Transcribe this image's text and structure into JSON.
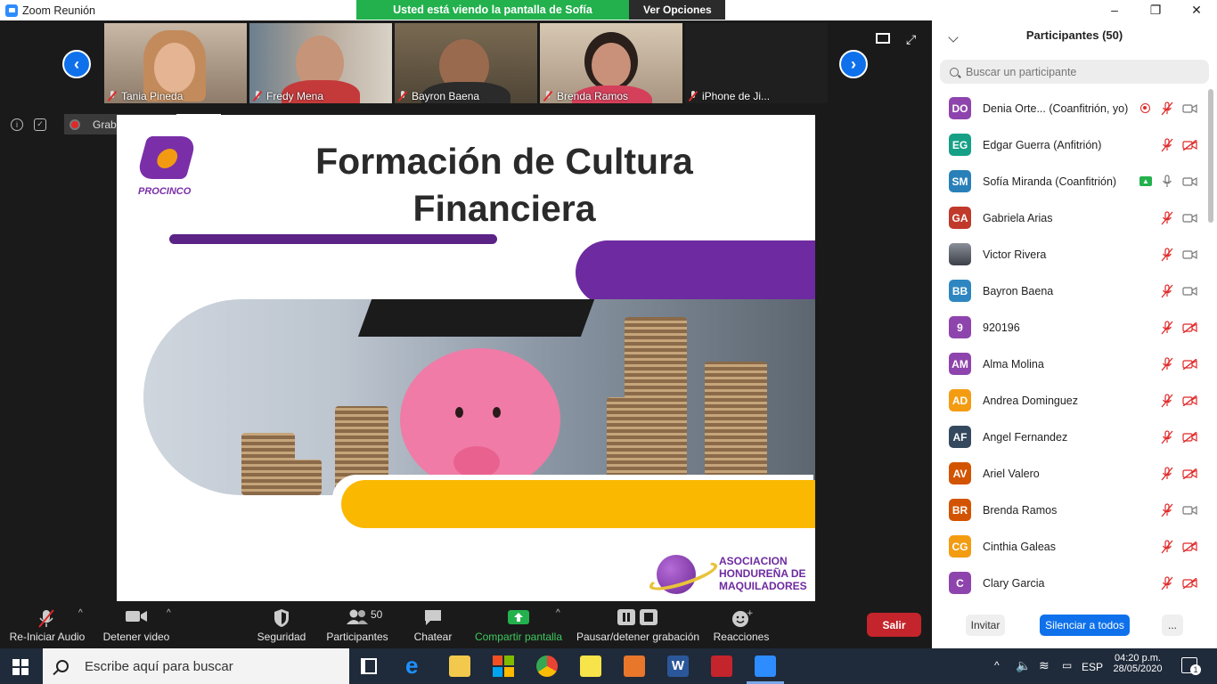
{
  "window": {
    "title": "Zoom Reunión"
  },
  "share_banner": {
    "text": "Usted está viendo la pantalla de Sofía Miranda",
    "options_label": "Ver Opciones"
  },
  "video_tiles": [
    {
      "name": "Tania Pineda"
    },
    {
      "name": "Fredy Mena"
    },
    {
      "name": "Bayron Baena"
    },
    {
      "name": "Brenda Ramos"
    },
    {
      "name": "iPhone de Ji..."
    }
  ],
  "recording": {
    "status": "Grabando..."
  },
  "slide": {
    "logo_text": "PROCINCO",
    "title_line1": "Formación de Cultura",
    "title_line2": "Financiera",
    "org_line1": "ASOCIACION",
    "org_line2": "HONDUREÑA DE",
    "org_line3": "MAQUILADORES"
  },
  "toolbar": {
    "audio": "Re-Iniciar Audio",
    "video": "Detener video",
    "security": "Seguridad",
    "participants": "Participantes",
    "participants_count": "50",
    "chat": "Chatear",
    "share": "Compartir pantalla",
    "recording": "Pausar/detener grabación",
    "reactions": "Reacciones",
    "leave": "Salir"
  },
  "panel": {
    "title": "Participantes (50)",
    "search_placeholder": "Buscar un participante",
    "invite": "Invitar",
    "mute_all": "Silenciar a todos",
    "more": "..."
  },
  "participants": [
    {
      "initials": "DO",
      "name": "Denia Orte...  (Coanfitrión, yo)",
      "color": "#8e44ad",
      "mic": "muted",
      "cam": "on",
      "badge": "rec"
    },
    {
      "initials": "EG",
      "name": "Edgar Guerra (Anfitrión)",
      "color": "#16a085",
      "mic": "muted",
      "cam": "off"
    },
    {
      "initials": "SM",
      "name": "Sofía Miranda (Coanfitrión)",
      "color": "#2980b9",
      "mic": "on",
      "cam": "on",
      "badge": "share"
    },
    {
      "initials": "GA",
      "name": "Gabriela Arias",
      "color": "#c0392b",
      "mic": "muted",
      "cam": "on"
    },
    {
      "initials": "",
      "name": "Victor Rivera",
      "color": "#6b7280",
      "mic": "muted",
      "cam": "on"
    },
    {
      "initials": "BB",
      "name": "Bayron Baena",
      "color": "#2e86c1",
      "mic": "muted",
      "cam": "on"
    },
    {
      "initials": "9",
      "name": "920196",
      "color": "#8e44ad",
      "mic": "muted",
      "cam": "off"
    },
    {
      "initials": "AM",
      "name": "Alma Molina",
      "color": "#8e44ad",
      "mic": "muted",
      "cam": "off"
    },
    {
      "initials": "AD",
      "name": "Andrea Dominguez",
      "color": "#f39c12",
      "mic": "muted",
      "cam": "off"
    },
    {
      "initials": "AF",
      "name": "Angel Fernandez",
      "color": "#34495e",
      "mic": "muted",
      "cam": "off"
    },
    {
      "initials": "AV",
      "name": "Ariel Valero",
      "color": "#d35400",
      "mic": "muted",
      "cam": "off"
    },
    {
      "initials": "BR",
      "name": "Brenda Ramos",
      "color": "#d35400",
      "mic": "muted",
      "cam": "on"
    },
    {
      "initials": "CG",
      "name": "Cinthia Galeas",
      "color": "#f39c12",
      "mic": "muted",
      "cam": "off"
    },
    {
      "initials": "C",
      "name": "Clary Garcia",
      "color": "#8e44ad",
      "mic": "muted",
      "cam": "off"
    }
  ],
  "taskbar": {
    "search_placeholder": "Escribe aquí para buscar",
    "language": "ESP",
    "time": "04:20 p.m.",
    "date": "28/05/2020",
    "notifications": "1"
  }
}
